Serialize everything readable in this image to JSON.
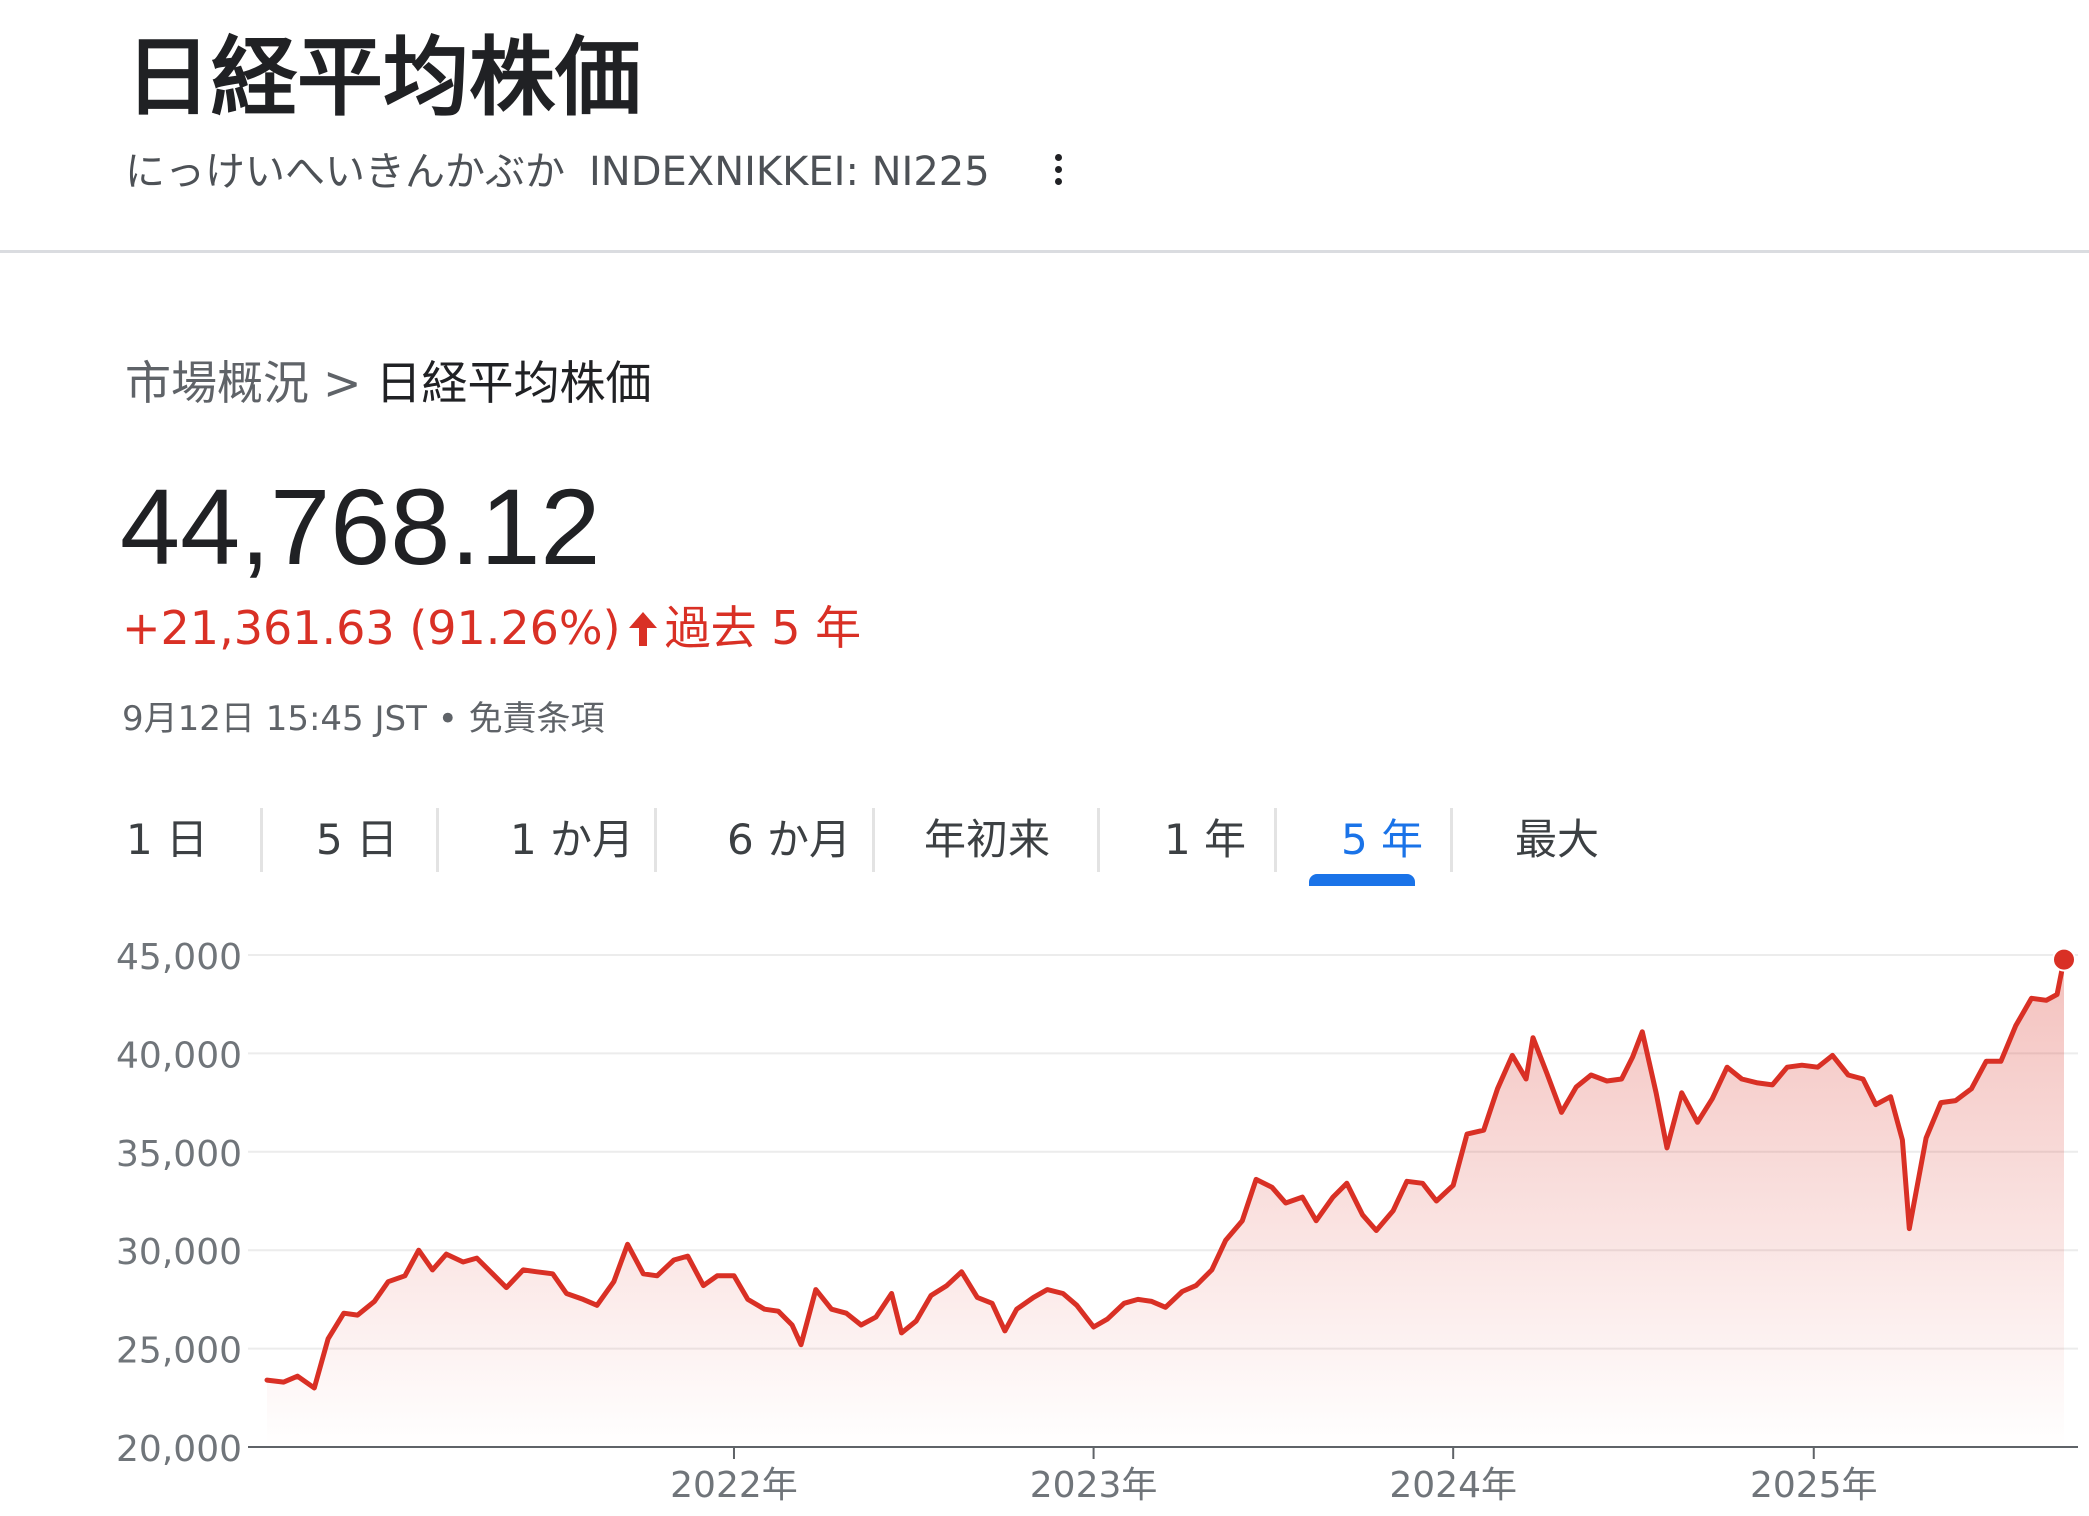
{
  "header": {
    "title": "日経平均株価",
    "reading": "にっけいへいきんかぶか",
    "ticker": "INDEXNIKKEI: NI225",
    "more_icon": "more-vert-icon"
  },
  "breadcrumb": {
    "parent": "市場概況",
    "separator": ">",
    "current": "日経平均株価"
  },
  "quote": {
    "price": "44,768.12",
    "change": "+21,361.63 (91.26%)",
    "change_icon": "arrow-up-icon",
    "period": "過去 5 年",
    "change_color": "#d93025",
    "timestamp": "9月12日 15:45 JST",
    "bullet": "•",
    "disclaimer": "免責条項"
  },
  "range_tabs": {
    "items": [
      "1 日",
      "5 日",
      "1 か月",
      "6 か月",
      "年初来",
      "1 年",
      "5 年",
      "最大"
    ],
    "selected": "5 年",
    "accent": "#1a73e8"
  },
  "chart_data": {
    "type": "area",
    "y_ticks": [
      "45,000",
      "40,000",
      "35,000",
      "30,000",
      "25,000",
      "20,000"
    ],
    "ylim": [
      20000,
      45000
    ],
    "x_ticks": [
      {
        "x": "2022-01-01",
        "label": "2022年"
      },
      {
        "x": "2023-01-01",
        "label": "2023年"
      },
      {
        "x": "2024-01-01",
        "label": "2024年"
      },
      {
        "x": "2025-01-01",
        "label": "2025年"
      }
    ],
    "xlim": [
      "2020-09-14",
      "2025-09-12"
    ],
    "grid": true,
    "line_color": "#d93025",
    "series": [
      {
        "points": [
          [
            "2020-09-14",
            23400
          ],
          [
            "2020-10-01",
            23300
          ],
          [
            "2020-10-15",
            23600
          ],
          [
            "2020-11-01",
            23000
          ],
          [
            "2020-11-15",
            25500
          ],
          [
            "2020-12-01",
            26800
          ],
          [
            "2020-12-15",
            26700
          ],
          [
            "2021-01-01",
            27400
          ],
          [
            "2021-01-15",
            28400
          ],
          [
            "2021-02-01",
            28700
          ],
          [
            "2021-02-15",
            30000
          ],
          [
            "2021-03-01",
            29000
          ],
          [
            "2021-03-15",
            29800
          ],
          [
            "2021-04-01",
            29400
          ],
          [
            "2021-04-15",
            29600
          ],
          [
            "2021-05-01",
            28800
          ],
          [
            "2021-05-15",
            28100
          ],
          [
            "2021-06-01",
            29000
          ],
          [
            "2021-06-15",
            28900
          ],
          [
            "2021-07-01",
            28800
          ],
          [
            "2021-07-15",
            27800
          ],
          [
            "2021-08-01",
            27500
          ],
          [
            "2021-08-15",
            27200
          ],
          [
            "2021-09-01",
            28400
          ],
          [
            "2021-09-15",
            30300
          ],
          [
            "2021-10-01",
            28800
          ],
          [
            "2021-10-15",
            28700
          ],
          [
            "2021-11-01",
            29500
          ],
          [
            "2021-11-15",
            29700
          ],
          [
            "2021-12-01",
            28200
          ],
          [
            "2021-12-15",
            28700
          ],
          [
            "2022-01-01",
            28700
          ],
          [
            "2022-01-15",
            27500
          ],
          [
            "2022-02-01",
            27000
          ],
          [
            "2022-02-15",
            26900
          ],
          [
            "2022-03-01",
            26200
          ],
          [
            "2022-03-10",
            25200
          ],
          [
            "2022-03-25",
            28000
          ],
          [
            "2022-04-10",
            27000
          ],
          [
            "2022-04-25",
            26800
          ],
          [
            "2022-05-10",
            26200
          ],
          [
            "2022-05-25",
            26600
          ],
          [
            "2022-06-10",
            27800
          ],
          [
            "2022-06-20",
            25800
          ],
          [
            "2022-07-05",
            26400
          ],
          [
            "2022-07-20",
            27700
          ],
          [
            "2022-08-05",
            28200
          ],
          [
            "2022-08-20",
            28900
          ],
          [
            "2022-09-05",
            27600
          ],
          [
            "2022-09-20",
            27300
          ],
          [
            "2022-10-03",
            25900
          ],
          [
            "2022-10-15",
            27000
          ],
          [
            "2022-11-01",
            27600
          ],
          [
            "2022-11-15",
            28000
          ],
          [
            "2022-12-01",
            27800
          ],
          [
            "2022-12-15",
            27200
          ],
          [
            "2023-01-01",
            26100
          ],
          [
            "2023-01-15",
            26500
          ],
          [
            "2023-02-01",
            27300
          ],
          [
            "2023-02-15",
            27500
          ],
          [
            "2023-03-01",
            27400
          ],
          [
            "2023-03-15",
            27100
          ],
          [
            "2023-04-01",
            27900
          ],
          [
            "2023-04-15",
            28200
          ],
          [
            "2023-05-01",
            29000
          ],
          [
            "2023-05-15",
            30500
          ],
          [
            "2023-06-01",
            31500
          ],
          [
            "2023-06-15",
            33600
          ],
          [
            "2023-07-01",
            33200
          ],
          [
            "2023-07-15",
            32400
          ],
          [
            "2023-08-01",
            32700
          ],
          [
            "2023-08-15",
            31500
          ],
          [
            "2023-09-01",
            32700
          ],
          [
            "2023-09-15",
            33400
          ],
          [
            "2023-10-01",
            31800
          ],
          [
            "2023-10-15",
            31000
          ],
          [
            "2023-11-01",
            32000
          ],
          [
            "2023-11-15",
            33500
          ],
          [
            "2023-12-01",
            33400
          ],
          [
            "2023-12-15",
            32500
          ],
          [
            "2024-01-01",
            33300
          ],
          [
            "2024-01-15",
            35900
          ],
          [
            "2024-02-01",
            36100
          ],
          [
            "2024-02-15",
            38200
          ],
          [
            "2024-03-01",
            39900
          ],
          [
            "2024-03-15",
            38700
          ],
          [
            "2024-03-22",
            40800
          ],
          [
            "2024-04-05",
            39000
          ],
          [
            "2024-04-20",
            37000
          ],
          [
            "2024-05-05",
            38300
          ],
          [
            "2024-05-20",
            38900
          ],
          [
            "2024-06-05",
            38600
          ],
          [
            "2024-06-20",
            38700
          ],
          [
            "2024-07-01",
            39800
          ],
          [
            "2024-07-11",
            41100
          ],
          [
            "2024-07-25",
            38000
          ],
          [
            "2024-08-05",
            35200
          ],
          [
            "2024-08-20",
            38000
          ],
          [
            "2024-09-05",
            36500
          ],
          [
            "2024-09-20",
            37700
          ],
          [
            "2024-10-05",
            39300
          ],
          [
            "2024-10-20",
            38700
          ],
          [
            "2024-11-05",
            38500
          ],
          [
            "2024-11-20",
            38400
          ],
          [
            "2024-12-05",
            39300
          ],
          [
            "2024-12-20",
            39400
          ],
          [
            "2025-01-05",
            39300
          ],
          [
            "2025-01-20",
            39900
          ],
          [
            "2025-02-05",
            38900
          ],
          [
            "2025-02-20",
            38700
          ],
          [
            "2025-03-05",
            37400
          ],
          [
            "2025-03-20",
            37800
          ],
          [
            "2025-04-01",
            35600
          ],
          [
            "2025-04-08",
            31100
          ],
          [
            "2025-04-25",
            35700
          ],
          [
            "2025-05-10",
            37500
          ],
          [
            "2025-05-25",
            37600
          ],
          [
            "2025-06-10",
            38200
          ],
          [
            "2025-06-25",
            39600
          ],
          [
            "2025-07-10",
            39600
          ],
          [
            "2025-07-25",
            41400
          ],
          [
            "2025-08-10",
            42800
          ],
          [
            "2025-08-25",
            42700
          ],
          [
            "2025-09-05",
            43000
          ],
          [
            "2025-09-12",
            44768.12
          ]
        ]
      }
    ]
  }
}
